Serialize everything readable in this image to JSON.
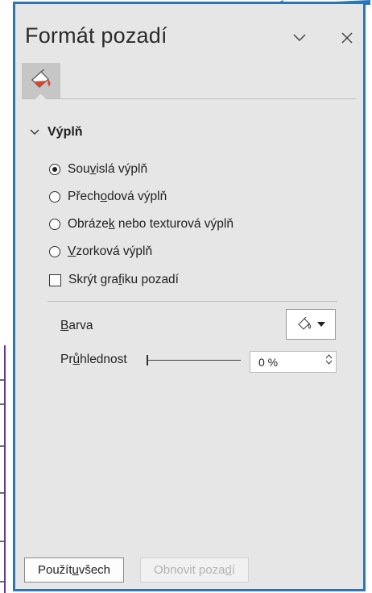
{
  "pane": {
    "title": "Formát pozadí",
    "tab_icon": "fill-bucket-icon"
  },
  "section": {
    "label": "Výplň",
    "expanded": true
  },
  "options": [
    {
      "pre": "Sou",
      "key": "v",
      "post": "islá výplň",
      "selected": true
    },
    {
      "pre": "Přech",
      "key": "o",
      "post": "dová výplň",
      "selected": false
    },
    {
      "pre": "Obráze",
      "key": "k",
      "post": " nebo texturová výplň",
      "selected": false
    },
    {
      "pre": "",
      "key": "V",
      "post": "zorková výplň",
      "selected": false
    }
  ],
  "hide_graphics": {
    "pre": "Skrýt gra",
    "key": "f",
    "post": "iku pozadí",
    "checked": false
  },
  "color": {
    "pre": "",
    "key": "B",
    "post": "arva"
  },
  "transparency": {
    "pre": "Pr",
    "key": "ů",
    "post": "hlednost",
    "value": "0 %",
    "level": 0
  },
  "buttons": {
    "apply": {
      "pre": "Použít ",
      "key": "u",
      "post": " všech"
    },
    "reset": {
      "pre": "Obnovit poza",
      "key": "d",
      "post": "í"
    }
  },
  "colors": {
    "accent_border": "#2e75b6",
    "panel_bg": "#e6e6e6",
    "fill_icon": "#d9462e"
  }
}
